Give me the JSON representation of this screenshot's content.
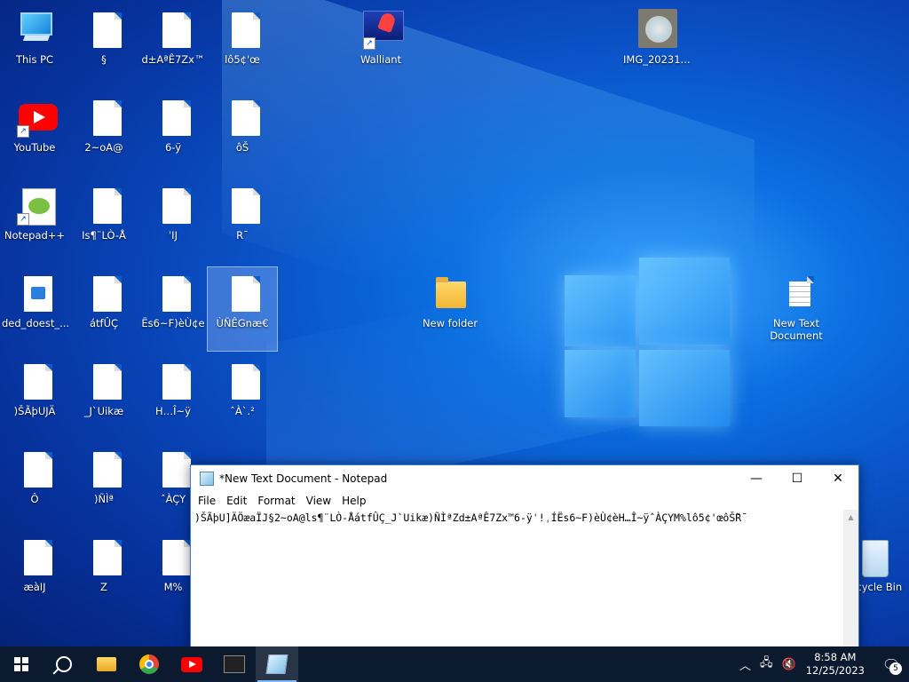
{
  "desktop": {
    "icons": {
      "this_pc": "This PC",
      "doc_section": "§",
      "doc_d": "d±AªÊ7Zx™",
      "doc_l": "lô5¢'œ",
      "walliant": "Walliant",
      "img": "IMG_20231...",
      "youtube": "YouTube",
      "doc_2": "2~oA@",
      "doc_6": "6-ÿ",
      "doc_os": "ôŠ",
      "notepadpp": "Notepad++",
      "doc_is": "Is¶¨LÒ-Å",
      "doc_ij": "ˈIJ",
      "doc_r": "R¯",
      "ded_doest": "ded_doest_...",
      "doc_atf": "átfÛÇ",
      "doc_es6": "Ës6~F)èÙ¢e",
      "doc_unegn": "ÙÑÊGnæ€",
      "new_folder": "New folder",
      "new_text_doc": "New Text Document",
      "doc_sap": ")ŠÃþUJÄ",
      "doc_uik": "_J`Uikæ",
      "doc_hi": "H…Î~ÿ",
      "doc_a2": "ˆÀ`.²",
      "doc_o": "Ô",
      "doc_n": ")ÑÌª",
      "doc_acy": "ˆÀÇY",
      "doc_ae": "æàIJ",
      "doc_z": "Z",
      "doc_m": "M%",
      "recycle": "Recycle Bin"
    }
  },
  "notepad": {
    "title": "*New Text Document - Notepad",
    "menu": [
      "File",
      "Edit",
      "Format",
      "View",
      "Help"
    ],
    "content": ")ŠÃþU]ÄÖæaÏJ§2~oA@ls¶¨LÒ-ÅátfÛÇ_J`Uikæ)ÑÌªZd±AªÊ7Zx™6-ÿˈ!ˌÍËs6~F)èÙ¢èH…Î~ÿˆÀÇYM%lô5¢'œôŠ̌R¯",
    "minimize": "—",
    "maximize": "☐",
    "close": "✕"
  },
  "taskbar": {
    "time": "8:58 AM",
    "date": "12/25/2023",
    "notification_count": "5"
  },
  "colors": {
    "desktop_bg": "#0a4fc4",
    "taskbar_bg": "#0b1a2e",
    "notepad_border": "#3c78d0"
  }
}
